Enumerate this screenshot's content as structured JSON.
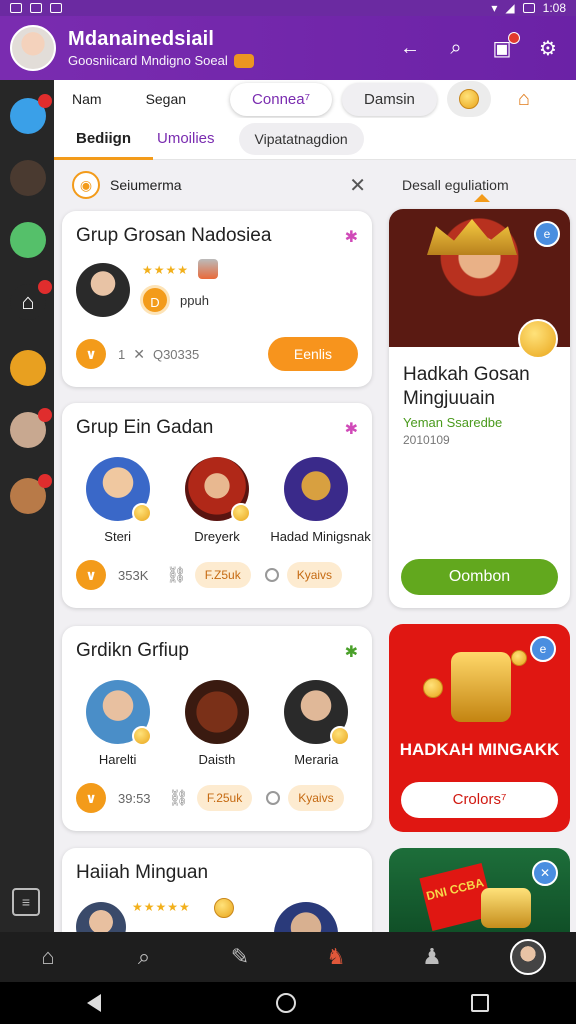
{
  "status_bar": {
    "time": "1:08"
  },
  "app_bar": {
    "title": "Mdanainedsiail",
    "subtitle": "Goosniicard Mndigno Soeal",
    "actions": [
      "back-arrow-icon",
      "search-icon",
      "wallet-icon",
      "gear-icon"
    ]
  },
  "tabs_row1": {
    "items": [
      "Nam",
      "Segan",
      "Connea⁷",
      "Damsin"
    ],
    "active": "Connea⁷"
  },
  "tabs_row2": {
    "items": [
      "Bediign",
      "Umoilies",
      "Vipatatnagdion"
    ],
    "active": "Bediign"
  },
  "filter": {
    "label": "Seiumerma"
  },
  "detail_header": {
    "label": "Desall eguliatiom"
  },
  "cards": [
    {
      "title": "Grup Grosan Nadosiea",
      "user_label": "ppuh",
      "badge_letter": "D",
      "count_prefix": "1",
      "count": "Q30335",
      "button": "Eenlis"
    },
    {
      "title": "Grup Ein Gadan",
      "members": [
        {
          "name": "Steri"
        },
        {
          "name": "Dreyerk"
        },
        {
          "name": "Hadad Minigsnak"
        }
      ],
      "count": "353K",
      "chip1": "F.Z5uk",
      "chip2": "Kyaivs"
    },
    {
      "title": "Grdikn Grfiup",
      "members": [
        {
          "name": "Harelti"
        },
        {
          "name": "Daisth"
        },
        {
          "name": "Meraria"
        }
      ],
      "count": "39:53",
      "chip1": "F.25uk",
      "chip2": "Kyaivs"
    },
    {
      "title": "Haiiah Minguan"
    }
  ],
  "feature1": {
    "title": "Hadkah Gosan Mingjuuain",
    "subtitle": "Yeman Ssaredbe",
    "date": "2010109",
    "button": "Oombon"
  },
  "feature2": {
    "title": "HADKAH MINGAKK",
    "button": "Crolors⁷"
  },
  "feature3": {
    "box_text": "DNI CCBA"
  },
  "bottom_nav": [
    "home-icon",
    "search-icon",
    "pen-icon",
    "game-icon",
    "profile-icon",
    "avatar"
  ],
  "colors": {
    "primary": "#7a2cb0",
    "accent": "#f39b1a",
    "green": "#62a81e",
    "red": "#e01712"
  }
}
